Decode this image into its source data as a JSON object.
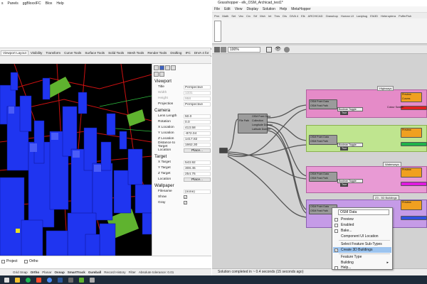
{
  "rhino": {
    "menubar": [
      "s",
      "Panels",
      "ggBloxxIFC",
      "Blox",
      "Help"
    ],
    "tabs": [
      {
        "label": "Viewport Layout",
        "active": true
      },
      {
        "label": "Visibility"
      },
      {
        "label": "Transform"
      },
      {
        "label": "Curve Tools"
      },
      {
        "label": "Surface Tools"
      },
      {
        "label": "Solid Tools"
      },
      {
        "label": "Mesh Tools"
      },
      {
        "label": "Render Tools"
      },
      {
        "label": "Drafting"
      },
      {
        "label": "IFC"
      },
      {
        "label": "DIVA 4 for"
      }
    ],
    "properties": {
      "viewport_title": "Viewport",
      "viewport_rows": [
        {
          "key": "Title",
          "value": "Perspective",
          "dim": false
        },
        {
          "key": "Width",
          "value": "1331",
          "dim": true
        },
        {
          "key": "Height",
          "value": "958",
          "dim": true
        },
        {
          "key": "Projection",
          "value": "Perspective",
          "dim": false
        }
      ],
      "camera_title": "Camera",
      "camera_rows": [
        {
          "key": "Lens Length",
          "value": "50.0"
        },
        {
          "key": "Rotation",
          "value": "0.0"
        },
        {
          "key": "X Location",
          "value": "413.58"
        },
        {
          "key": "Y Location",
          "value": "-872.04"
        },
        {
          "key": "Z Location",
          "value": "1417.82"
        },
        {
          "key": "Distance to Target",
          "value": "1662.30"
        },
        {
          "key": "Location",
          "value": "Place..."
        }
      ],
      "target_title": "Target",
      "target_rows": [
        {
          "key": "X Target",
          "value": "543.92"
        },
        {
          "key": "Y Target",
          "value": "308.45"
        },
        {
          "key": "Z Target",
          "value": "254.76"
        },
        {
          "key": "Location",
          "value": "Place..."
        }
      ],
      "wallpaper_title": "Wallpaper",
      "wallpaper_rows": [
        {
          "key": "Filename",
          "value": "(none)"
        },
        {
          "key": "Show",
          "value": "✓"
        },
        {
          "key": "Gray",
          "value": "✓"
        }
      ]
    },
    "lower_panel": [
      "Project",
      "Ortho"
    ],
    "statusbar": [
      {
        "label": "Grid Snap",
        "bold": false
      },
      {
        "label": "Ortho",
        "bold": true
      },
      {
        "label": "Planar",
        "bold": false
      },
      {
        "label": "Osnap",
        "bold": true
      },
      {
        "label": "SmartTrack",
        "bold": true
      },
      {
        "label": "Gumball",
        "bold": true
      },
      {
        "label": "Record History",
        "bold": false
      },
      {
        "label": "Filter",
        "bold": false
      },
      {
        "label": "Absolute tolerance: 0.01",
        "bold": false
      }
    ]
  },
  "grasshopper": {
    "title": "Grasshopper - elk_OSM_Archicad_test1*",
    "menu": [
      "File",
      "Edit",
      "View",
      "Display",
      "Solution",
      "Help",
      "MetaHopper"
    ],
    "tabs": [
      "Prm",
      "Math",
      "Set",
      "Vec",
      "Crv",
      "Srf",
      "Msh",
      "Int",
      "Trns",
      "Dis",
      "DIVA 4",
      "Elk",
      "ARCHICAD",
      "Grasshop",
      "Human UI",
      "Ladybug",
      "Elk3D",
      "Heteroptera",
      "PufferFish"
    ],
    "zoom": "100%",
    "status": "Solution completed in ~ 0.4 seconds (15 seconds ago)",
    "canvas": {
      "group_labels": [
        "Highways",
        "Waterways",
        "Waterways",
        "Z3 - 3D Buildings"
      ],
      "node_osm_data": "OSM Data",
      "node_file_path": "File Path",
      "node_osm_lines": [
        "OSM Point Data",
        "Collection",
        "Longitude Domain",
        "Latitude Domain"
      ],
      "sub_node_lines": [
        "OSM Point Data",
        "OSM Feat Path"
      ],
      "toggle_label": "Boolean Toggle",
      "toggle_value": "True",
      "colour_swatch": "Colour Swatch",
      "curve_out": "Curves",
      "preview_node": "Preview"
    },
    "context_menu": {
      "field_value": "OSM Data",
      "items": [
        {
          "label": "Preview",
          "icon": "",
          "highlight": false
        },
        {
          "label": "Enabled",
          "icon": "",
          "highlight": false
        },
        {
          "label": "Bake...",
          "icon": "",
          "highlight": false
        },
        {
          "label": "Component UI Location",
          "icon": "",
          "highlight": false
        },
        {
          "label": "Select Feature Sub-Types",
          "icon": "",
          "highlight": false
        },
        {
          "label": "Create 3D Buildings",
          "icon": "✓",
          "highlight": true
        },
        {
          "label": "Feature Type",
          "icon": "",
          "highlight": false
        },
        {
          "label": "Building",
          "icon": "",
          "highlight": false,
          "arrow": "▸"
        },
        {
          "label": "Help...",
          "icon": "",
          "highlight": false
        }
      ]
    }
  },
  "colors": {
    "buildings": "#1f35f0",
    "grass": "#5fb32f",
    "roads": "#cc1111",
    "group_pink": "#e58bc8",
    "group_green": "#bfe58f",
    "group_purple": "#c59be7",
    "swatch_red": "#e02020",
    "swatch_green": "#1fb34a",
    "swatch_magenta": "#e01ae0",
    "menu_highlight": "#9cc4ef"
  }
}
